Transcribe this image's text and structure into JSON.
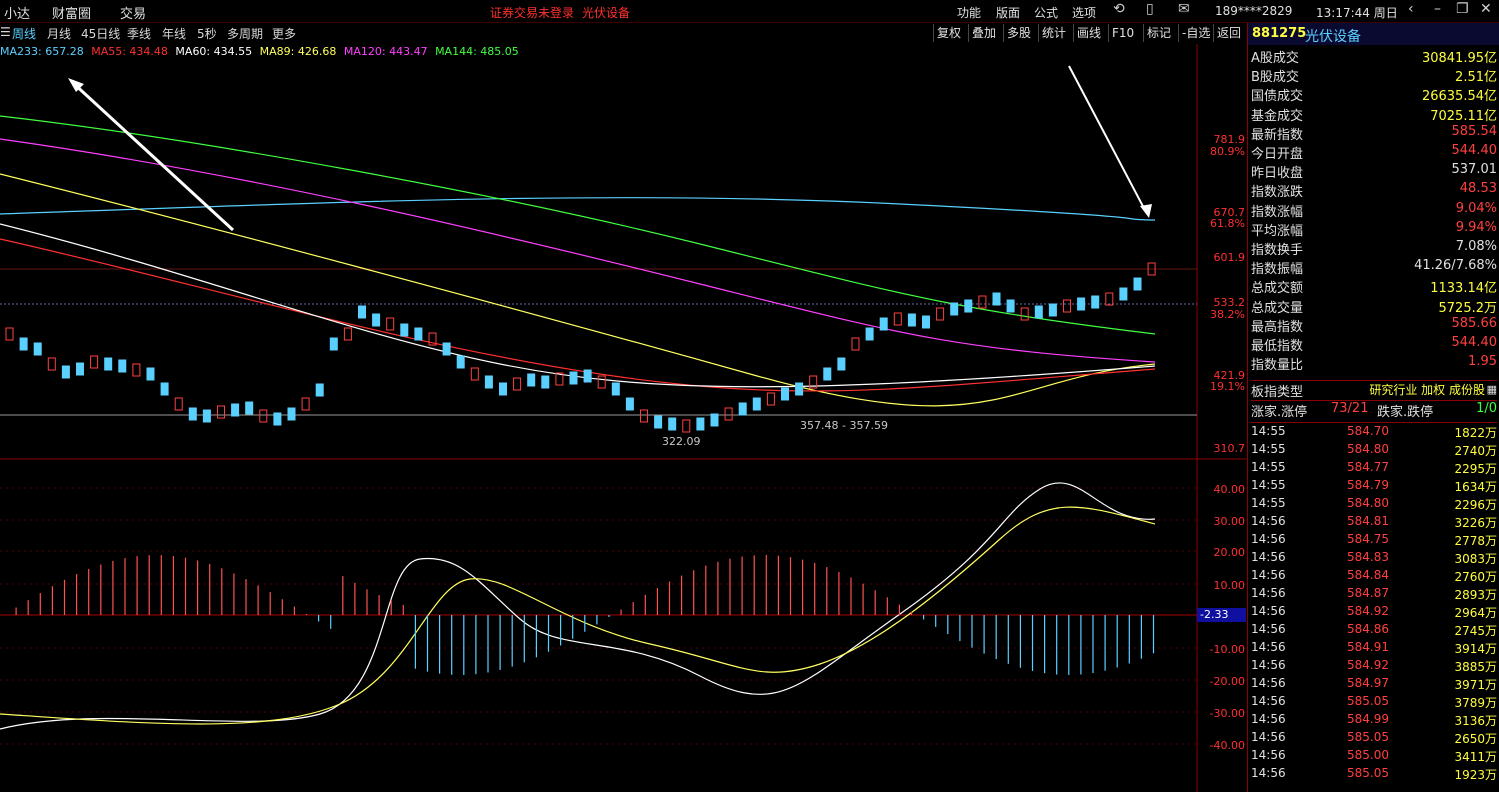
{
  "topbar": {
    "menus": [
      "小达",
      "财富圈",
      "交易"
    ],
    "status": "证券交易未登录",
    "stock_name": "光伏设备",
    "right_menus": [
      "功能",
      "版面",
      "公式",
      "选项"
    ],
    "account": "189****2829",
    "clock": "13:17:44 周日"
  },
  "period_tabs": [
    "周线",
    "月线",
    "45日线",
    "季线",
    "年线",
    "5秒",
    "多周期",
    "更多"
  ],
  "active_period": "周线",
  "tool_buttons": [
    "复权",
    "叠加",
    "多股",
    "统计",
    "画线",
    "F10",
    "标记",
    "-自选",
    "返回"
  ],
  "ma_labels": [
    {
      "text": "MA233: 657.28",
      "color": "#5ad0ff"
    },
    {
      "text": "MA55: 434.48",
      "color": "#ff3030"
    },
    {
      "text": "MA60: 434.55",
      "color": "#ffffff"
    },
    {
      "text": "MA89: 426.68",
      "color": "#ffff60"
    },
    {
      "text": "MA120: 443.47",
      "color": "#ff40ff"
    },
    {
      "text": "MA144: 485.05",
      "color": "#40ff40"
    }
  ],
  "price_axis": [
    {
      "label": "781.9"
    },
    {
      "label": "80.9%"
    },
    {
      "label": "670.7"
    },
    {
      "label": "61.8%"
    },
    {
      "label": "601.9"
    },
    {
      "label": "533.2"
    },
    {
      "label": "38.2%"
    },
    {
      "label": "421.9"
    },
    {
      "label": "19.1%"
    },
    {
      "label": "310.7"
    }
  ],
  "macd_axis": [
    "40.00",
    "30.00",
    "20.00",
    "10.00",
    "-2.33",
    "-10.00",
    "-20.00",
    "-30.00",
    "-40.00"
  ],
  "annotations": {
    "low_label": "322.09",
    "range_label": "357.48 - 357.59"
  },
  "right_panel": {
    "code": "881275",
    "name": "光伏设备",
    "stats": [
      {
        "k": "A股成交",
        "v": "30841.95亿",
        "c": "y"
      },
      {
        "k": "B股成交",
        "v": "2.51亿",
        "c": "y"
      },
      {
        "k": "国债成交",
        "v": "26635.54亿",
        "c": "y"
      },
      {
        "k": "基金成交",
        "v": "7025.11亿",
        "c": "y"
      },
      {
        "k": "最新指数",
        "v": "585.54",
        "c": "r"
      },
      {
        "k": "今日开盘",
        "v": "544.40",
        "c": "r"
      },
      {
        "k": "昨日收盘",
        "v": "537.01",
        "c": "w"
      },
      {
        "k": "指数涨跌",
        "v": "48.53",
        "c": "r"
      },
      {
        "k": "指数涨幅",
        "v": "9.04%",
        "c": "r"
      },
      {
        "k": "平均涨幅",
        "v": "9.94%",
        "c": "r"
      },
      {
        "k": "指数换手",
        "v": "7.08%",
        "c": "w"
      },
      {
        "k": "指数振幅",
        "v": "41.26/7.68%",
        "c": "w"
      },
      {
        "k": "总成交额",
        "v": "1133.14亿",
        "c": "y"
      },
      {
        "k": "总成交量",
        "v": "5725.2万",
        "c": "y"
      },
      {
        "k": "最高指数",
        "v": "585.66",
        "c": "r"
      },
      {
        "k": "最低指数",
        "v": "544.40",
        "c": "r"
      },
      {
        "k": "指数量比",
        "v": "1.95",
        "c": "r"
      }
    ],
    "board_type_label": "板指类型",
    "board_type_value": "研究行业 加权 成份股",
    "up_label": "涨家.涨停",
    "up_value": "73/21",
    "down_label": "跌家.跌停",
    "down_value": "1/0",
    "ticks": [
      {
        "t": "14:55",
        "p": "584.70",
        "v": "1822万"
      },
      {
        "t": "14:55",
        "p": "584.80",
        "v": "2740万"
      },
      {
        "t": "14:55",
        "p": "584.77",
        "v": "2295万"
      },
      {
        "t": "14:55",
        "p": "584.79",
        "v": "1634万"
      },
      {
        "t": "14:55",
        "p": "584.80",
        "v": "2296万"
      },
      {
        "t": "14:56",
        "p": "584.81",
        "v": "3226万"
      },
      {
        "t": "14:56",
        "p": "584.75",
        "v": "2778万"
      },
      {
        "t": "14:56",
        "p": "584.83",
        "v": "3083万"
      },
      {
        "t": "14:56",
        "p": "584.84",
        "v": "2760万"
      },
      {
        "t": "14:56",
        "p": "584.87",
        "v": "2893万"
      },
      {
        "t": "14:56",
        "p": "584.92",
        "v": "2964万"
      },
      {
        "t": "14:56",
        "p": "584.86",
        "v": "2745万"
      },
      {
        "t": "14:56",
        "p": "584.91",
        "v": "3914万"
      },
      {
        "t": "14:56",
        "p": "584.92",
        "v": "3885万"
      },
      {
        "t": "14:56",
        "p": "584.97",
        "v": "3971万"
      },
      {
        "t": "14:56",
        "p": "585.05",
        "v": "3789万"
      },
      {
        "t": "14:56",
        "p": "584.99",
        "v": "3136万"
      },
      {
        "t": "14:56",
        "p": "585.05",
        "v": "2650万"
      },
      {
        "t": "14:56",
        "p": "585.00",
        "v": "3411万"
      },
      {
        "t": "14:56",
        "p": "585.05",
        "v": "1923万"
      }
    ]
  }
}
